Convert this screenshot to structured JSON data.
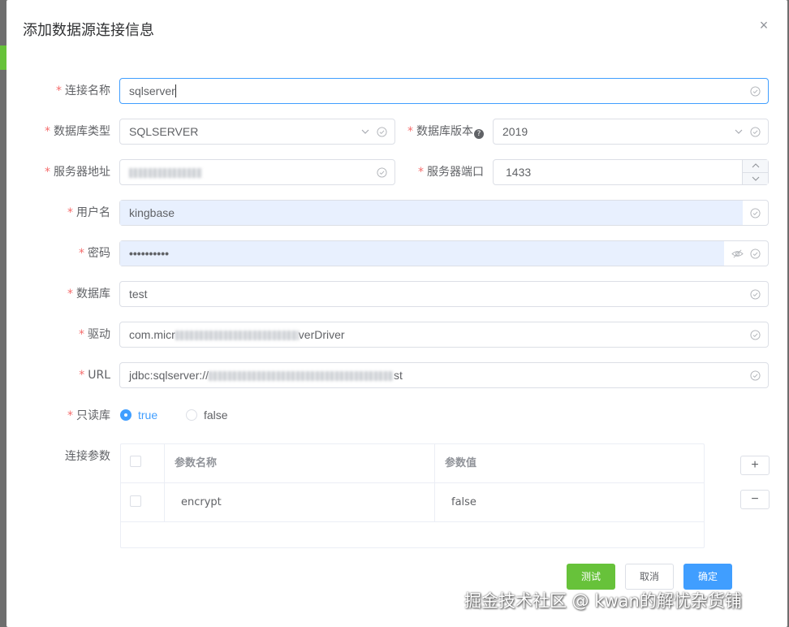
{
  "dialog": {
    "title": "添加数据源连接信息",
    "close_glyph": "×"
  },
  "form": {
    "required_mark": "*",
    "connection_name": {
      "label": "连接名称",
      "value": "sqlserver"
    },
    "db_type": {
      "label": "数据库类型",
      "value": "SQLSERVER"
    },
    "db_version": {
      "label": "数据库版本",
      "help_glyph": "?",
      "value": "2019"
    },
    "server_address": {
      "label": "服务器地址",
      "value": ""
    },
    "server_port": {
      "label": "服务器端口",
      "value": "1433"
    },
    "username": {
      "label": "用户名",
      "value": "kingbase"
    },
    "password": {
      "label": "密码",
      "value": "••••••••••"
    },
    "database": {
      "label": "数据库",
      "value": "test"
    },
    "driver": {
      "label": "驱动",
      "value_prefix": "com.micr",
      "value_suffix": "verDriver"
    },
    "url": {
      "label": "URL",
      "value_prefix": "jdbc:sqlserver://",
      "value_suffix": "st"
    },
    "readonly": {
      "label": "只读库",
      "options": [
        "true",
        "false"
      ],
      "selected": "true"
    },
    "params": {
      "label": "连接参数",
      "headers": [
        "参数名称",
        "参数值"
      ],
      "rows": [
        {
          "name": "encrypt",
          "value": "false"
        }
      ],
      "add_glyph": "+",
      "remove_glyph": "−"
    }
  },
  "footer": {
    "test_label": "测试",
    "cancel_label": "取消",
    "confirm_label": "确定"
  },
  "watermark": "掘金技术社区 @ kwan的解忧杂货铺",
  "colors": {
    "primary": "#409eff",
    "success": "#67c23a",
    "danger": "#f56c6c",
    "autofill": "#e8f0fe"
  },
  "icons": [
    "close-icon",
    "circle-check-icon",
    "chevron-down-icon",
    "help-icon",
    "eye-off-icon",
    "caret-up-icon",
    "caret-down-icon",
    "plus-icon",
    "minus-icon"
  ]
}
